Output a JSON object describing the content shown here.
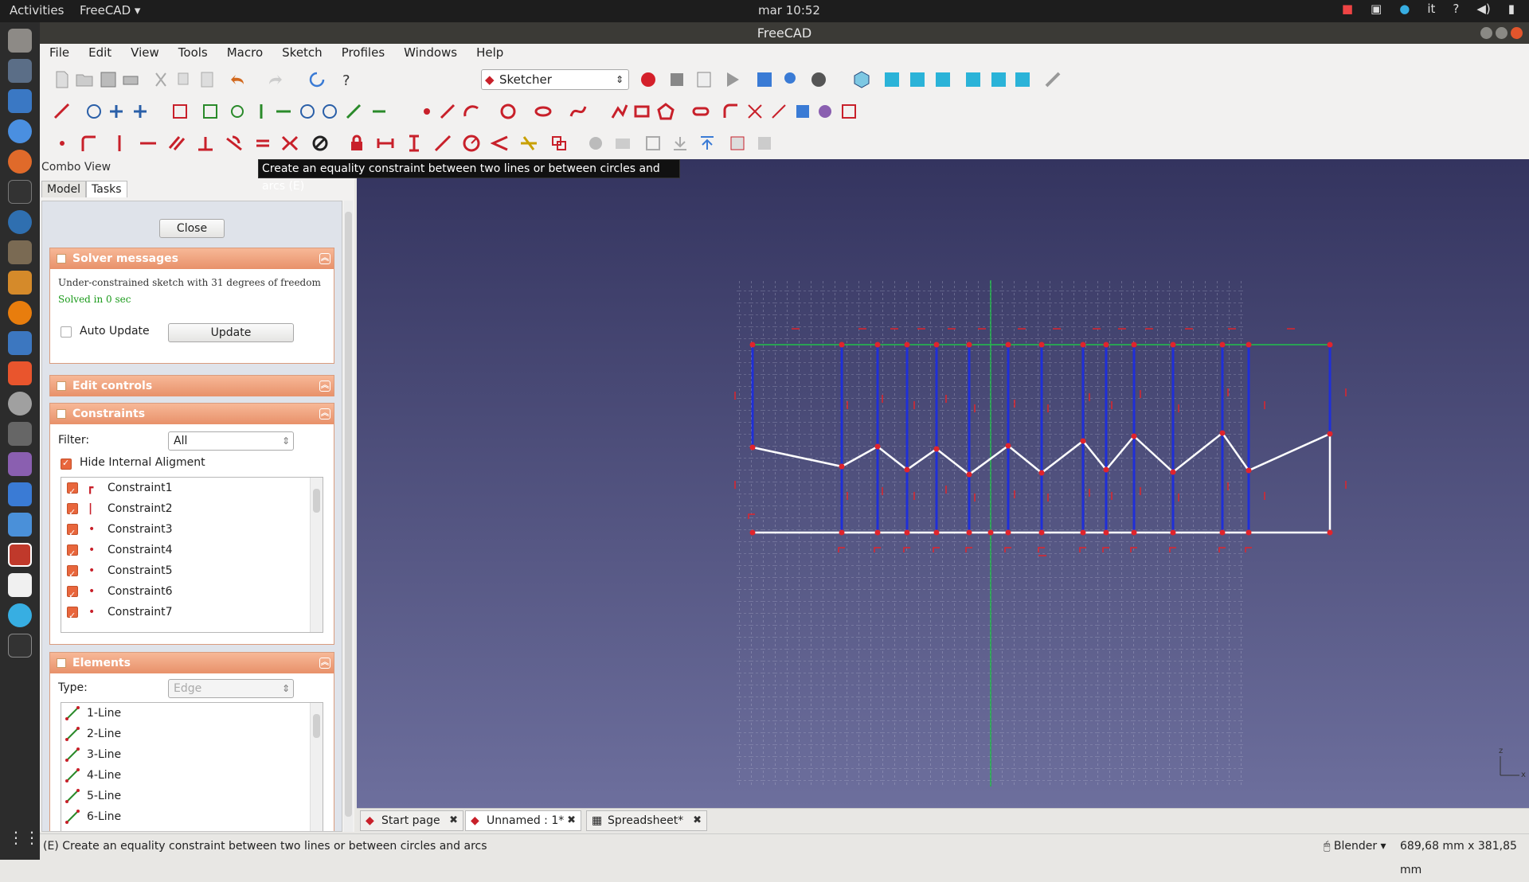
{
  "topbar": {
    "activities": "Activities",
    "app": "FreeCAD",
    "clock": "mar 10:52",
    "lang": "it",
    "help": "?"
  },
  "window": {
    "title": "FreeCAD"
  },
  "menu": {
    "items": [
      "File",
      "Edit",
      "View",
      "Tools",
      "Macro",
      "Sketch",
      "Profiles",
      "Windows",
      "Help"
    ]
  },
  "workbench": {
    "value": "Sketcher"
  },
  "tooltip": "Create an equality constraint between two lines or between circles and arcs (E)",
  "combo": {
    "label": "Combo View",
    "tabs": [
      "Model",
      "Tasks"
    ],
    "close": "Close",
    "solver": {
      "title": "Solver messages",
      "msg": "Under-constrained sketch with 31 degrees of freedom",
      "solved": "Solved in 0 sec",
      "auto_update": "Auto Update",
      "update": "Update"
    },
    "edit_controls": {
      "title": "Edit controls"
    },
    "constraints": {
      "title": "Constraints",
      "filter_label": "Filter:",
      "filter_value": "All",
      "hide_internal": "Hide Internal Aligment",
      "items": [
        "Constraint1",
        "Constraint2",
        "Constraint3",
        "Constraint4",
        "Constraint5",
        "Constraint6",
        "Constraint7"
      ]
    },
    "elements": {
      "title": "Elements",
      "type_label": "Type:",
      "type_value": "Edge",
      "items": [
        "1-Line",
        "2-Line",
        "3-Line",
        "4-Line",
        "5-Line",
        "6-Line"
      ]
    }
  },
  "doc_tabs": [
    "Start page",
    "Unnamed : 1*",
    "Spreadsheet*"
  ],
  "status": {
    "message": "(E) Create an equality constraint between two lines or between circles and arcs",
    "nav": "Blender",
    "dimensions": "689,68 mm x 381,85 mm"
  },
  "colors": {
    "accent": "#e8916a",
    "viewport_top": "#34345f",
    "viewport_bottom": "#6d6f9d",
    "constraint_red": "#c8202a",
    "construction_blue": "#1f2fd8"
  }
}
